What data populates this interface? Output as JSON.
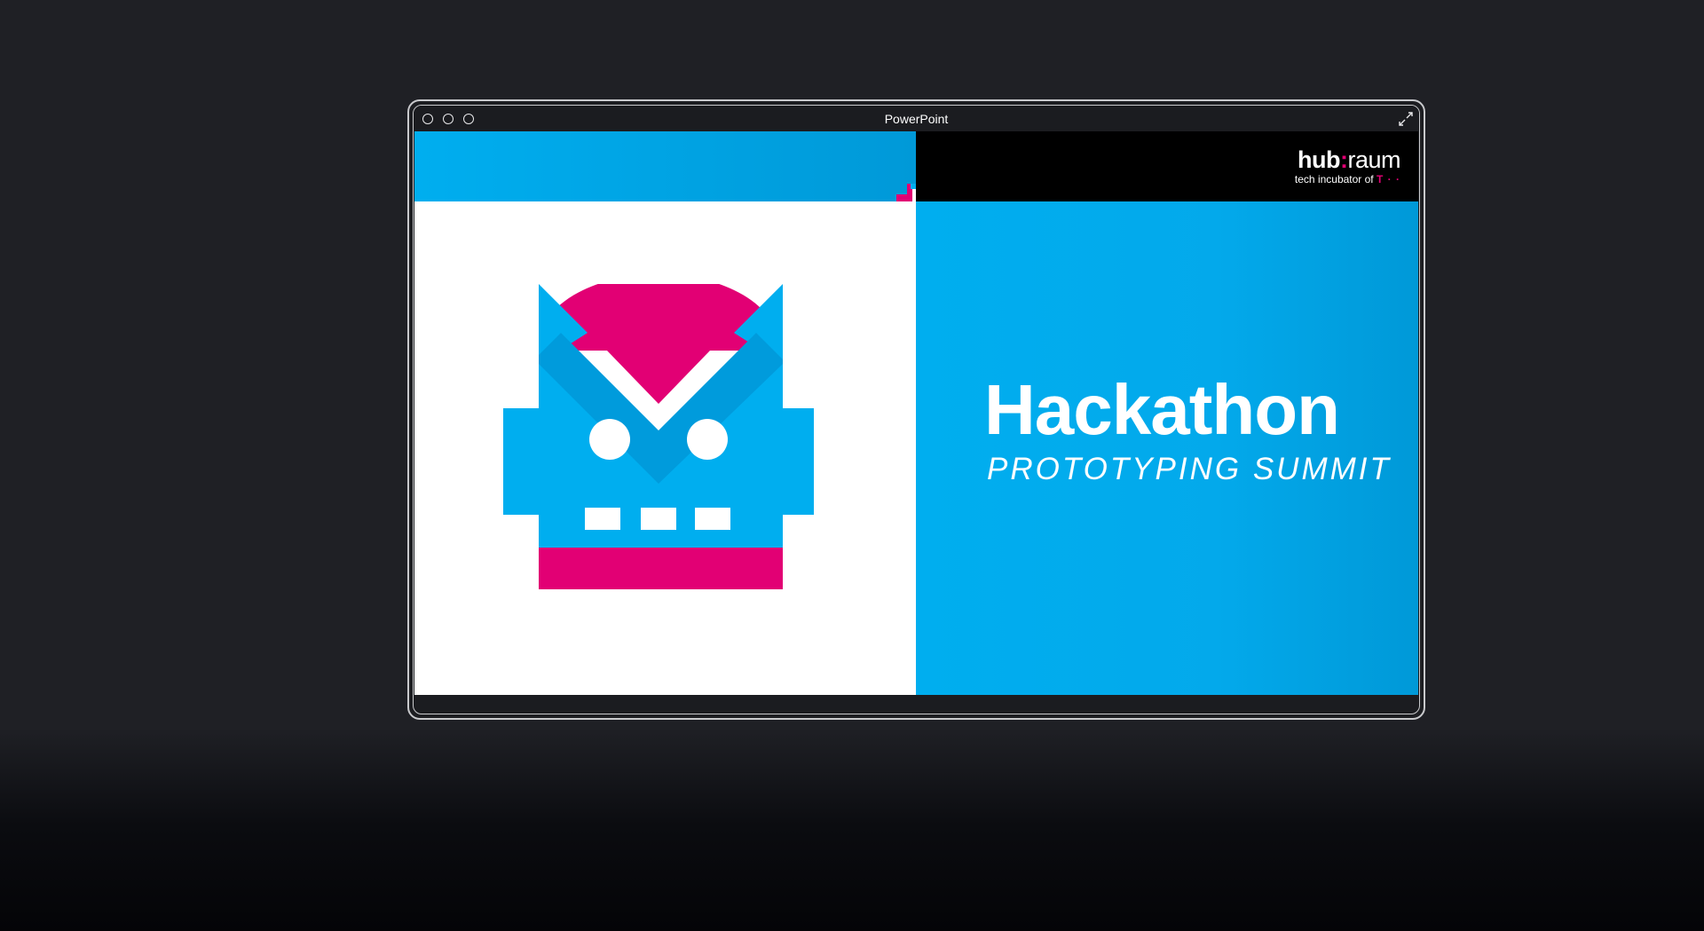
{
  "window": {
    "title": "PowerPoint"
  },
  "slide": {
    "logo": {
      "hub": "hub",
      "colon": ":",
      "raum": "raum",
      "tagline": "tech incubator of",
      "brand_mark": "T · ·"
    },
    "headline": "Hackathon",
    "subheadline": "PROTOTYPING SUMMIT"
  },
  "colors": {
    "cyan": "#00aeef",
    "magenta": "#e20074",
    "black": "#000000",
    "white": "#ffffff",
    "background": "#1f2025"
  },
  "icons": {
    "resize": "exit-fullscreen-icon",
    "mascot": "robot-mascot-icon"
  }
}
